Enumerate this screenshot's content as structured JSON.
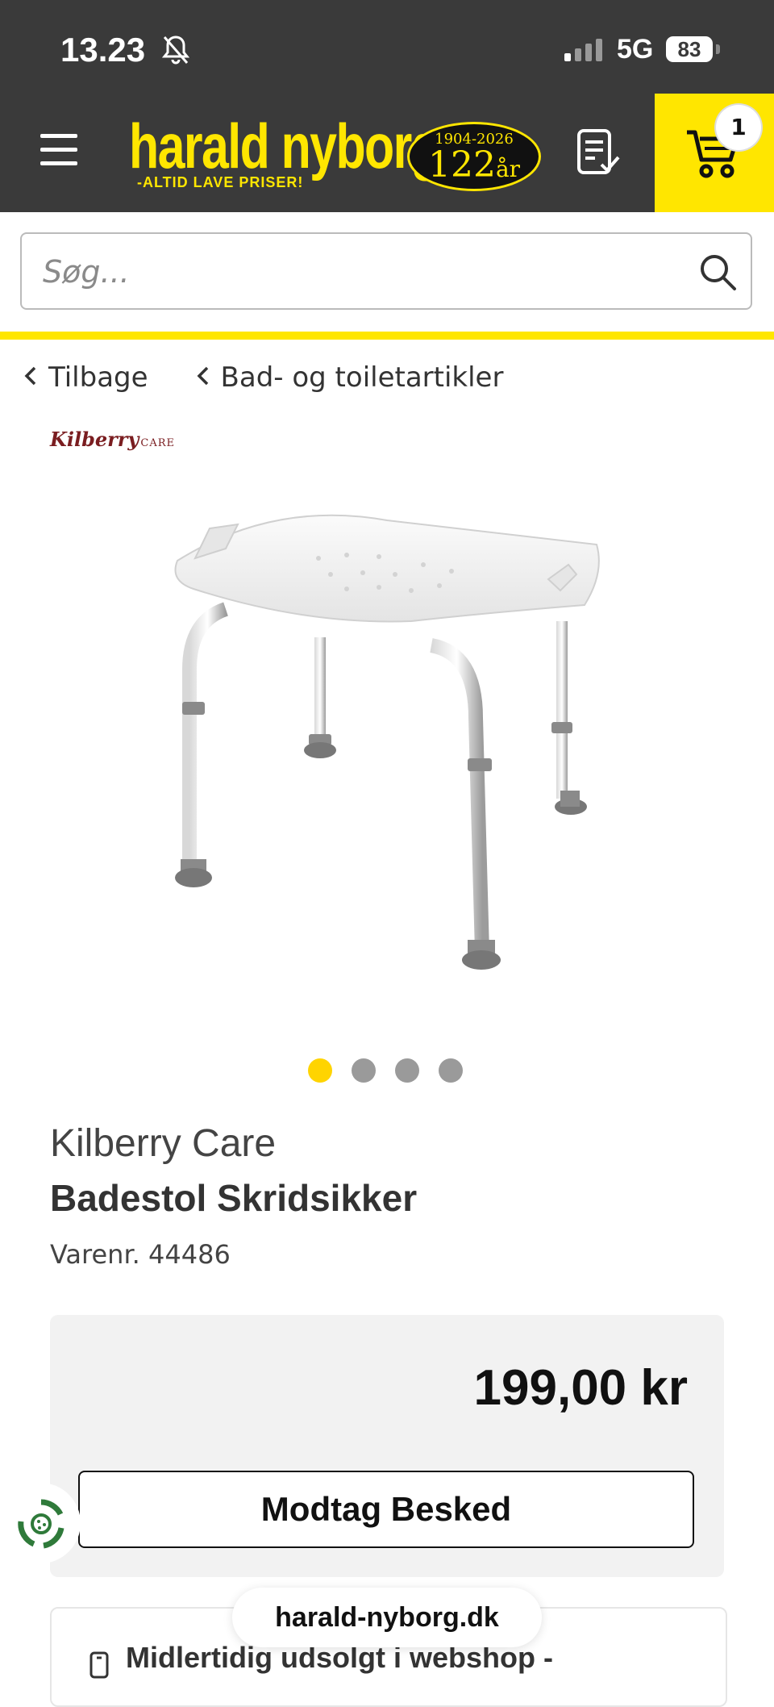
{
  "status_bar": {
    "time": "13.23",
    "network": "5G",
    "battery": "83"
  },
  "header": {
    "logo_name": "harald nyborg",
    "logo_tagline": "-ALTID LAVE PRISER!",
    "anniversary_years": "1904-2026",
    "anniversary_number": "122",
    "anniversary_suffix": "år",
    "cart_count": "1",
    "accent_color": "#ffe600"
  },
  "search": {
    "placeholder": "Søg..."
  },
  "breadcrumbs": [
    {
      "label": "Tilbage"
    },
    {
      "label": "Bad- og toiletartikler"
    }
  ],
  "product": {
    "brand_logo": "Kilberry",
    "brand_logo_suffix": "CARE",
    "brand": "Kilberry Care",
    "title": "Badestol Skridsikker",
    "sku": "Varenr. 44486",
    "price": "199,00 kr",
    "notify_label": "Modtag Besked",
    "image_count": 4,
    "active_image_index": 1
  },
  "stock": {
    "text": "Midlertidig udsolgt i webshop -"
  },
  "browser": {
    "url": "harald-nyborg.dk"
  }
}
